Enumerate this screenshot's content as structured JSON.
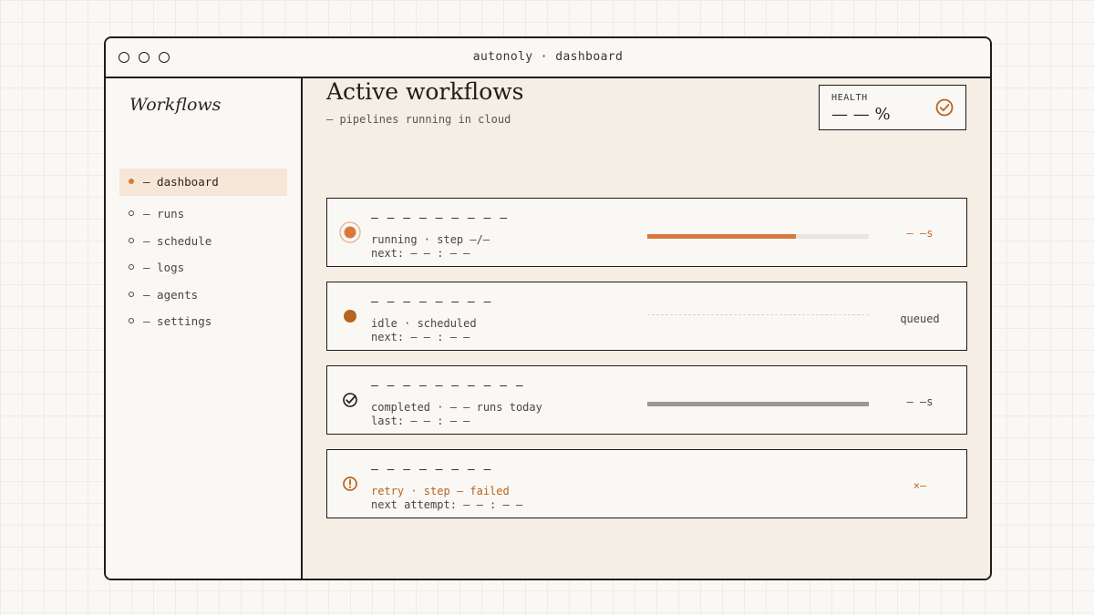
{
  "window": {
    "title": "autonoly · dashboard"
  },
  "sidebar": {
    "title": "Workflows",
    "items": [
      {
        "label": "— dashboard",
        "active": true
      },
      {
        "label": "— runs",
        "active": false
      },
      {
        "label": "— schedule",
        "active": false
      },
      {
        "label": "— logs",
        "active": false
      },
      {
        "label": "— agents",
        "active": false
      },
      {
        "label": "— settings",
        "active": false
      }
    ]
  },
  "main": {
    "title": "Active workflows",
    "subtitle": "— pipelines running in cloud",
    "health": {
      "label": "HEALTH",
      "value": "— — %",
      "icon": "check-circle-icon"
    },
    "workflows": [
      {
        "name": "— — — — — — — — —",
        "status": "running · step —/—",
        "next": "next: — — : — —",
        "right": "— —s",
        "icon": "running-indicator-icon",
        "progress": 0.67
      },
      {
        "name": "— — — — — — — —",
        "status": "idle · scheduled",
        "next": "next: — — : — —",
        "right": "queued",
        "icon": "idle-dot-icon",
        "progress": null
      },
      {
        "name": "— — — — — — — — — —",
        "status": "completed · — — runs today",
        "next": "last: — — : — —",
        "right": "— —s",
        "icon": "check-circle-icon",
        "progress": 1.0
      },
      {
        "name": "— — — — — — — —",
        "status": "retry · step — failed",
        "next": "next attempt: — — : — —",
        "right": "×—",
        "icon": "alert-circle-icon",
        "progress": null
      }
    ]
  },
  "colors": {
    "accent": "#d9783b",
    "accent_dark": "#b8631f",
    "active_nav_bg": "#f6e6d7",
    "main_bg": "#f5eee5",
    "progress_gray": "#9a9893"
  }
}
